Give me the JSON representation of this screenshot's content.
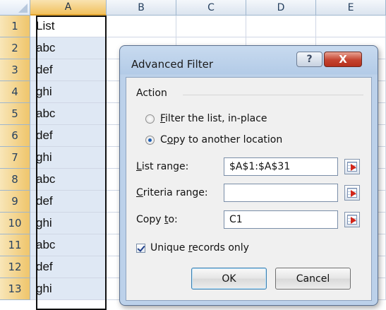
{
  "sheet": {
    "columns": [
      "A",
      "B",
      "C",
      "D",
      "E"
    ],
    "rows": [
      {
        "num": "1",
        "a": "List"
      },
      {
        "num": "2",
        "a": "abc"
      },
      {
        "num": "3",
        "a": "def"
      },
      {
        "num": "4",
        "a": "ghi"
      },
      {
        "num": "5",
        "a": "abc"
      },
      {
        "num": "6",
        "a": "def"
      },
      {
        "num": "7",
        "a": "ghi"
      },
      {
        "num": "8",
        "a": "abc"
      },
      {
        "num": "9",
        "a": "def"
      },
      {
        "num": "10",
        "a": "ghi"
      },
      {
        "num": "11",
        "a": "abc"
      },
      {
        "num": "12",
        "a": "def"
      },
      {
        "num": "13",
        "a": "ghi"
      }
    ]
  },
  "dialog": {
    "title": "Advanced Filter",
    "help_glyph": "?",
    "close_glyph": "X",
    "action_group": "Action",
    "radio_filter": {
      "accel": "F",
      "rest": "ilter the list, in-place"
    },
    "radio_copy": {
      "pre": "C",
      "accel": "o",
      "rest": "py to another location"
    },
    "list_range": {
      "accel": "L",
      "rest": "ist range:",
      "value": "$A$1:$A$31"
    },
    "criteria_range": {
      "accel": "C",
      "rest": "riteria range:",
      "value": ""
    },
    "copy_to": {
      "pre": "Copy ",
      "accel": "t",
      "rest": "o:",
      "value": "C1"
    },
    "unique": {
      "pre": "Unique ",
      "accel": "r",
      "rest": "ecords only"
    },
    "ok_label": "OK",
    "cancel_label": "Cancel"
  },
  "state": {
    "selected_radio": "copy",
    "unique_checked": true
  }
}
